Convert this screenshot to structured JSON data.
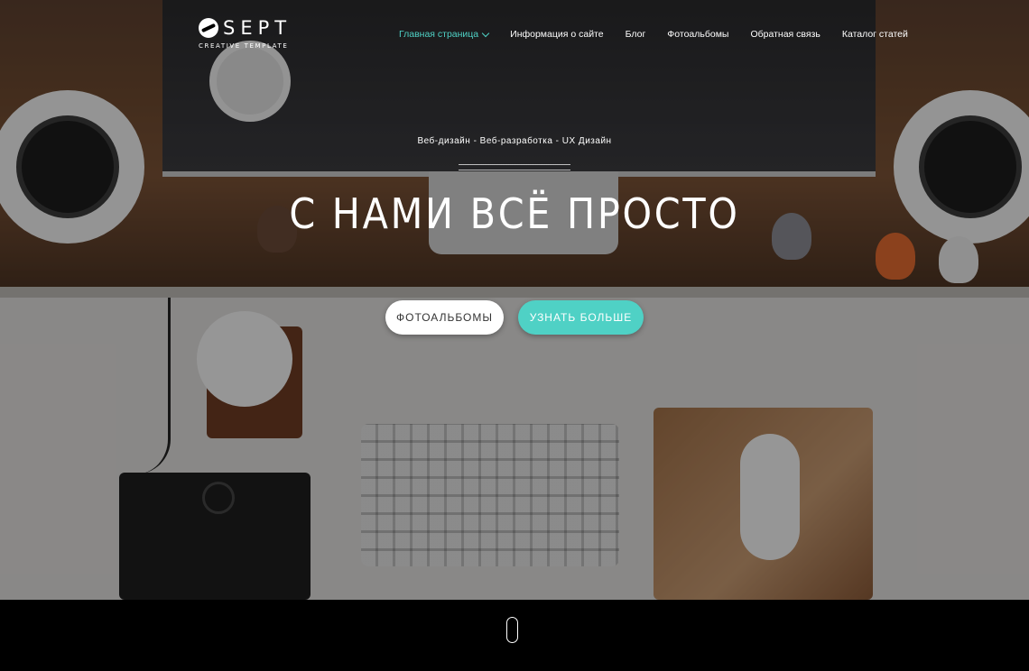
{
  "logo": {
    "name": "SEPT",
    "subtitle": "CREATIVE TEMPLATE"
  },
  "nav": {
    "items": [
      {
        "label": "Главная страница",
        "active": true,
        "dropdown": true
      },
      {
        "label": "Информация о сайте"
      },
      {
        "label": "Блог"
      },
      {
        "label": "Фотоальбомы"
      },
      {
        "label": "Обратная связь"
      },
      {
        "label": "Каталог статей"
      }
    ]
  },
  "hero": {
    "tagline": "Веб-дизайн - Веб-разработка - UX Дизайн",
    "headline": "С НАМИ ВСЁ ПРОСТО",
    "buttons": {
      "albums": "ФОТОАЛЬБОМЫ",
      "learn_more": "УЗНАТЬ БОЛЬШЕ"
    }
  },
  "colors": {
    "accent": "#4fd1c5",
    "footer": "#000000"
  },
  "icons": {
    "logo": "coffee-bean-logo-icon",
    "dropdown": "chevron-down-icon",
    "scroll": "scroll-mouse-icon"
  }
}
